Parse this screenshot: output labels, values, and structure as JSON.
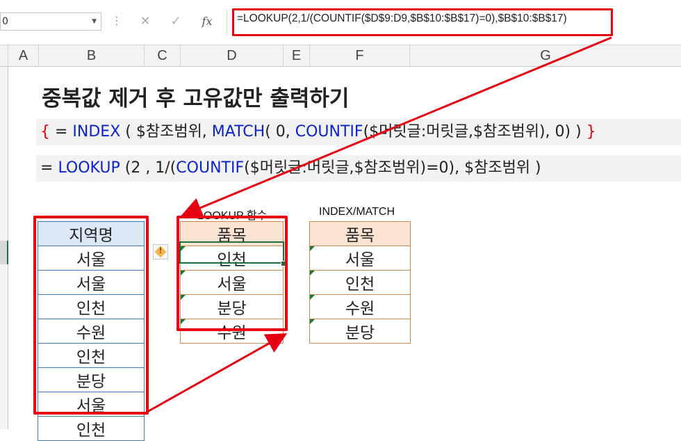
{
  "formula_bar": {
    "name_box": "0",
    "cancel_icon": "close-icon",
    "enter_icon": "check-icon",
    "fx_label": "fx",
    "formula": "=LOOKUP(2,1/(COUNTIF($D$9:D9,$B$10:$B$17)=0),$B$10:$B$17)"
  },
  "columns": [
    "A",
    "B",
    "C",
    "D",
    "E",
    "F",
    "G"
  ],
  "title": "중복값 제거 후 고유값만 출력하기",
  "formula_line_1": {
    "brace_open": "{",
    "eq": " = ",
    "index": "INDEX",
    "p1": " ( $참조범위, ",
    "match": "MATCH",
    "p2": "( 0, ",
    "countif": "COUNTIF",
    "p3": "($머릿글:머릿글,$참조범위), 0) ) ",
    "brace_close": "}"
  },
  "formula_line_2": {
    "eq": "= ",
    "lookup": "LOOKUP",
    "p1": " (2 , 1/(",
    "countif": "COUNTIF",
    "p2": "($머릿글:머릿글,$참조범위)=0), $참조범위 )"
  },
  "source_table": {
    "header": "지역명",
    "rows": [
      "서울",
      "서울",
      "인천",
      "수원",
      "인천",
      "분당",
      "서울",
      "인천"
    ]
  },
  "lookup_table": {
    "label": "LOOKUP 함수",
    "header": "품목",
    "rows": [
      "인천",
      "서울",
      "분당",
      "수원"
    ]
  },
  "index_table": {
    "label": "INDEX/MATCH",
    "header": "품목",
    "rows": [
      "서울",
      "인천",
      "수원",
      "분당"
    ]
  },
  "colors": {
    "highlight_red": "#e60012",
    "function_blue": "#0b24c8",
    "excel_green": "#1e6e3e"
  }
}
